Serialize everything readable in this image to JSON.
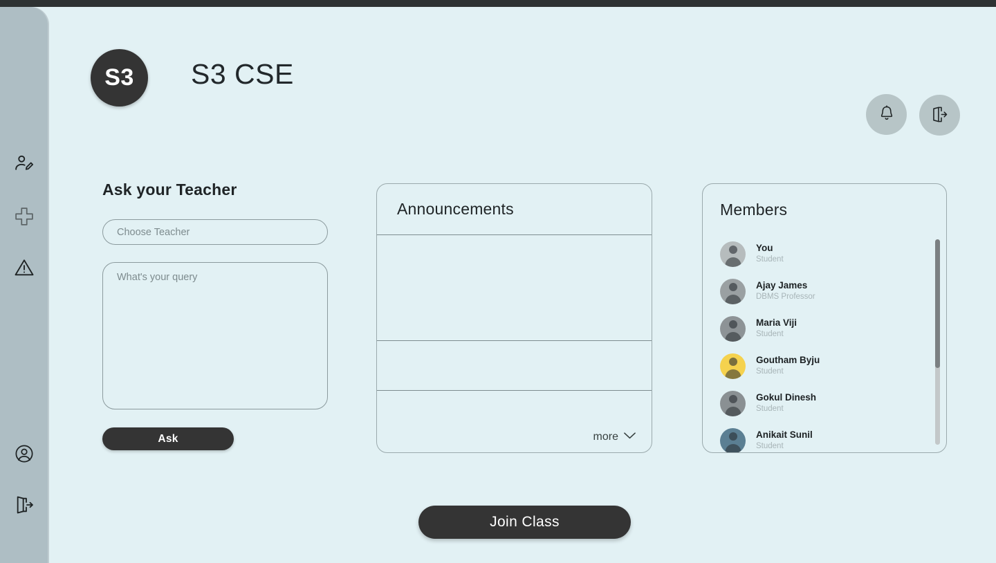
{
  "app": {
    "class_badge": "S3",
    "class_title": "S3 CSE",
    "background_color": "#e2f1f4",
    "sidebar_color": "#aebec4",
    "accent_dark": "#343434"
  },
  "sidebar": {
    "items": [
      {
        "icon": "user-edit-icon",
        "name": "edit-profile"
      },
      {
        "icon": "plus-icon",
        "name": "create"
      },
      {
        "icon": "warning-triangle-icon",
        "name": "report"
      },
      {
        "icon": "user-circle-icon",
        "name": "account"
      },
      {
        "icon": "logout-icon",
        "name": "logout"
      }
    ]
  },
  "header": {
    "notification_icon": "bell-icon",
    "leave_icon": "exit-door-icon"
  },
  "ask_teacher": {
    "title": "Ask your Teacher",
    "teacher_select_value": "",
    "teacher_select_placeholder": "Choose Teacher",
    "query_value": "",
    "query_placeholder": "What's your query",
    "submit_label": "Ask"
  },
  "announcements": {
    "title": "Announcements",
    "rows": [
      "",
      "",
      ""
    ],
    "more_label": "more",
    "more_icon": "chevron-down-icon"
  },
  "members": {
    "title": "Members",
    "list": [
      {
        "name": "You",
        "role": "Student",
        "avatar_color": "#b6bcbd"
      },
      {
        "name": "Ajay James",
        "role": "DBMS Professor",
        "avatar_color": "#9aa0a2"
      },
      {
        "name": "Maria Viji",
        "role": "Student",
        "avatar_color": "#8d9396"
      },
      {
        "name": "Goutham Byju",
        "role": "Student",
        "avatar_color": "#f5d24e"
      },
      {
        "name": "Gokul Dinesh",
        "role": "Student",
        "avatar_color": "#8a9093"
      },
      {
        "name": "Anikait Sunil",
        "role": "Student",
        "avatar_color": "#5b7f93"
      }
    ]
  },
  "footer": {
    "join_label": "Join Class"
  }
}
